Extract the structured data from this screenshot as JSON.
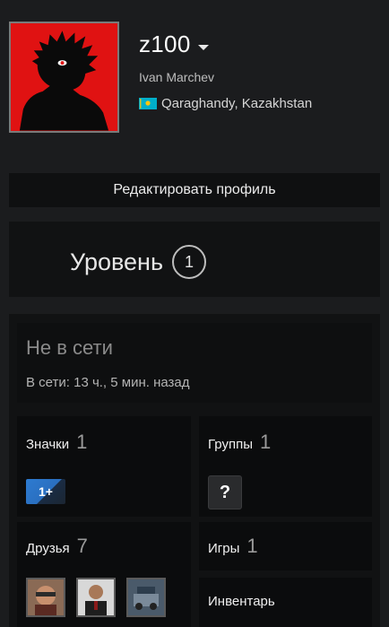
{
  "profile": {
    "username": "z100",
    "real_name": "Ivan Marchev",
    "location": "Qaraghandy, Kazakhstan",
    "flag_icon": "kazakhstan-flag-icon",
    "avatar_bg": "#e01212"
  },
  "edit_button": {
    "label": "Редактировать профиль"
  },
  "level": {
    "label": "Уровень",
    "value": "1"
  },
  "status": {
    "title": "Не в сети",
    "last_online": "В сети: 13 ч., 5 мин. назад"
  },
  "badges": {
    "label": "Значки",
    "count": "1",
    "badge_text": "1+"
  },
  "groups": {
    "label": "Группы",
    "count": "1",
    "placeholder_icon": "?"
  },
  "friends": {
    "label": "Друзья",
    "count": "7",
    "avatars": [
      "friend-avatar-1",
      "friend-avatar-2",
      "friend-avatar-3"
    ]
  },
  "games": {
    "label": "Игры",
    "count": "1"
  },
  "inventory": {
    "label": "Инвентарь"
  }
}
